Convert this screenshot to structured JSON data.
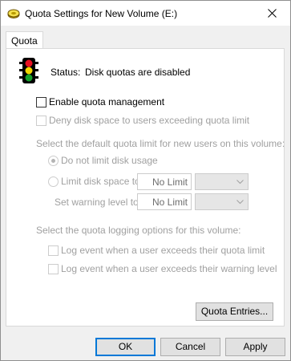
{
  "window": {
    "title": "Quota Settings for New Volume (E:)"
  },
  "tabs": [
    {
      "label": "Quota"
    }
  ],
  "status": {
    "label": "Status:",
    "value": "Disk quotas are disabled",
    "icon": "traffic-light-icon"
  },
  "options": {
    "enable_quota": {
      "label": "Enable quota management",
      "checked": false
    },
    "deny_space": {
      "label": "Deny disk space to users exceeding quota limit",
      "checked": false,
      "enabled": false
    }
  },
  "default_limit": {
    "heading": "Select the default quota limit for new users on this volume:",
    "no_limit": {
      "label": "Do not limit disk usage",
      "selected": true
    },
    "limit_to": {
      "label": "Limit disk space to",
      "value": "No Limit",
      "unit": ""
    },
    "warning_level": {
      "label": "Set warning level to",
      "value": "No Limit",
      "unit": ""
    }
  },
  "logging": {
    "heading": "Select the quota logging options for this volume:",
    "log_quota": {
      "label": "Log event when a user exceeds their quota limit",
      "checked": false
    },
    "log_warning": {
      "label": "Log event when a user exceeds their warning level",
      "checked": false
    }
  },
  "buttons": {
    "quota_entries": "Quota Entries...",
    "ok": "OK",
    "cancel": "Cancel",
    "apply": "Apply"
  },
  "colors": {
    "accent": "#0078d7",
    "disabled_text": "#a0a0a0",
    "light_red": "#e81123",
    "light_yellow": "#f2d600",
    "light_green": "#16a02b"
  }
}
